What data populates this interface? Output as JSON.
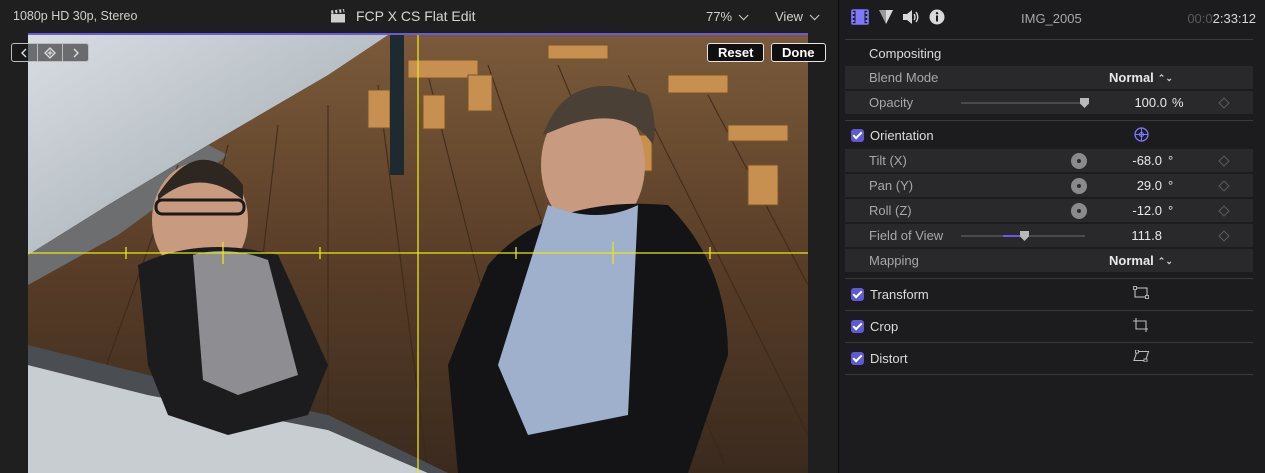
{
  "viewer": {
    "format_info": "1080p HD 30p, Stereo",
    "project_title": "FCP X CS Flat Edit",
    "zoom_level": "77%",
    "view_menu": "View",
    "overlay": {
      "reset_label": "Reset",
      "done_label": "Done"
    },
    "icons": {
      "title": "clapperboard-icon",
      "prev_keyframe": "previous-keyframe-icon",
      "add_keyframe": "add-keyframe-icon",
      "next_keyframe": "next-keyframe-icon"
    },
    "colors": {
      "accent": "#6a5ae0",
      "guide_lines": "#e6e61a"
    }
  },
  "inspector": {
    "tabs": [
      "video-inspector-icon",
      "color-inspector-icon",
      "audio-inspector-icon",
      "info-inspector-icon"
    ],
    "clip_name": "IMG_2005",
    "clip_duration_dim": "00:0",
    "clip_duration": "2:33:12",
    "compositing": {
      "title": "Compositing",
      "blend_mode_label": "Blend Mode",
      "blend_mode_value": "Normal",
      "opacity_label": "Opacity",
      "opacity_value": "100.0",
      "opacity_unit": "%",
      "opacity_level": 1.0
    },
    "orientation": {
      "title": "Orientation",
      "tilt_label": "Tilt (X)",
      "tilt_value": "-68.0",
      "pan_label": "Pan (Y)",
      "pan_value": "29.0",
      "roll_label": "Roll (Z)",
      "roll_value": "-12.0",
      "degree_unit": "°",
      "fov_label": "Field of View",
      "fov_value": "111.8",
      "mapping_label": "Mapping",
      "mapping_value": "Normal"
    },
    "transform": {
      "title": "Transform"
    },
    "crop": {
      "title": "Crop"
    },
    "distort": {
      "title": "Distort"
    }
  }
}
